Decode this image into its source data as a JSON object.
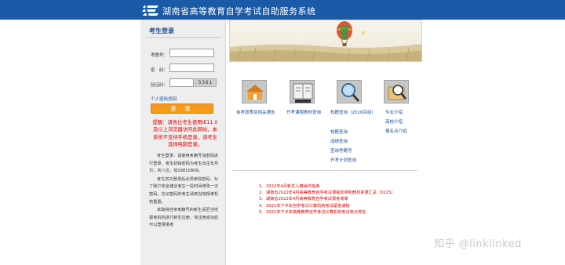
{
  "header": {
    "title": "湖南省高等教育自学考试自助服务系统",
    "bg_color": "#1a5aa6"
  },
  "login": {
    "title": "考生登录",
    "exam_no_label": "考籍号：",
    "password_label": "密　码：",
    "captcha_label": "验证码：",
    "captcha_text": "5361",
    "forgot_link": "个人密码找回",
    "login_button": "登 录",
    "warning": "提醒：请各位考生使用IE11.0及以上浏览器访问此网站，本系统不支持手机登录，请考生选择电脑登录。",
    "notes": [
      "考生登录：请使用考籍号加密码进行登录，考生初始密码为考生出生年月日，共八位，如19810809。",
      "考生初次登录后必须修改密码，为了账户安全建议考生一段时间修改一次密码，忘记密码的考生请到当地报考机构重置。",
      "未取得自考考籍号的新生请至当地报考机构进行新生注册，快注册成功后可以登录报考"
    ]
  },
  "icons": [
    {
      "name": "house-icon",
      "color": "#f0a035"
    },
    {
      "name": "book-icon",
      "color": "#888888"
    },
    {
      "name": "magnifier-icon",
      "color": "#4a90c8"
    },
    {
      "name": "magnifier-folder-icon",
      "color": "#d2a450"
    }
  ],
  "links": {
    "col1": [
      "自考政策及相关通告"
    ],
    "col2": [
      "开考课程教材查询"
    ],
    "col3": [
      "校籍查询（2016目前）",
      "校籍查询",
      "成绩查询",
      "查询考籍号",
      "开考计划查询"
    ],
    "col4": [
      "专业介绍",
      "高校介绍",
      "报名点介绍"
    ]
  },
  "news": [
    "2022年4月新生入籍操作指南",
    "湖南省2022年4月高等教育自学考试课程安排和教材变更汇总（0115）",
    "湖南省2022年4月高等教育自学考试报考简章",
    "2021年下半年自学考试计算机统考试紧急通知",
    "2021年下半年高等教育自学考试计算机统考试考点地址"
  ],
  "watermark": "知乎 @linklinked"
}
